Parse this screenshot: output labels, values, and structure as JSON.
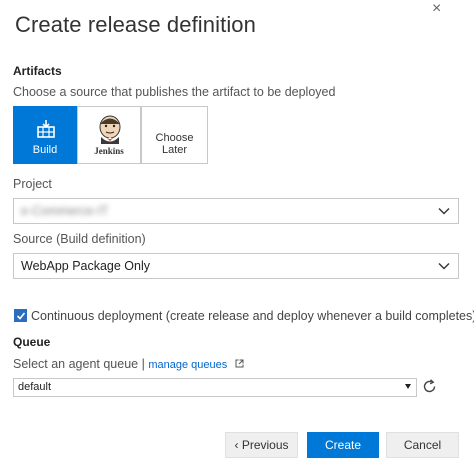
{
  "dialog": {
    "title": "Create release definition",
    "close_icon": "×"
  },
  "artifacts": {
    "heading": "Artifacts",
    "description": "Choose a source that publishes the artifact to be deployed",
    "sources": [
      {
        "label": "Build",
        "icon": "build-icon",
        "selected": true
      },
      {
        "label": "Jenkins",
        "icon": "jenkins-icon",
        "selected": false
      },
      {
        "label": "Choose Later",
        "icon": "",
        "selected": false
      }
    ]
  },
  "project": {
    "label": "Project",
    "value": "e-Commerce-IT"
  },
  "build_definition": {
    "label": "Source (Build definition)",
    "value": "WebApp Package Only"
  },
  "continuous_deployment": {
    "checked": true,
    "label": "Continuous deployment (create release and deploy whenever a build completes)"
  },
  "queue": {
    "heading": "Queue",
    "description": "Select an agent queue |",
    "manage_link": "manage queues",
    "value": "default"
  },
  "buttons": {
    "previous": "‹ Previous",
    "create": "Create",
    "cancel": "Cancel"
  },
  "colors": {
    "accent": "#0078d7",
    "link": "#0066cc"
  }
}
